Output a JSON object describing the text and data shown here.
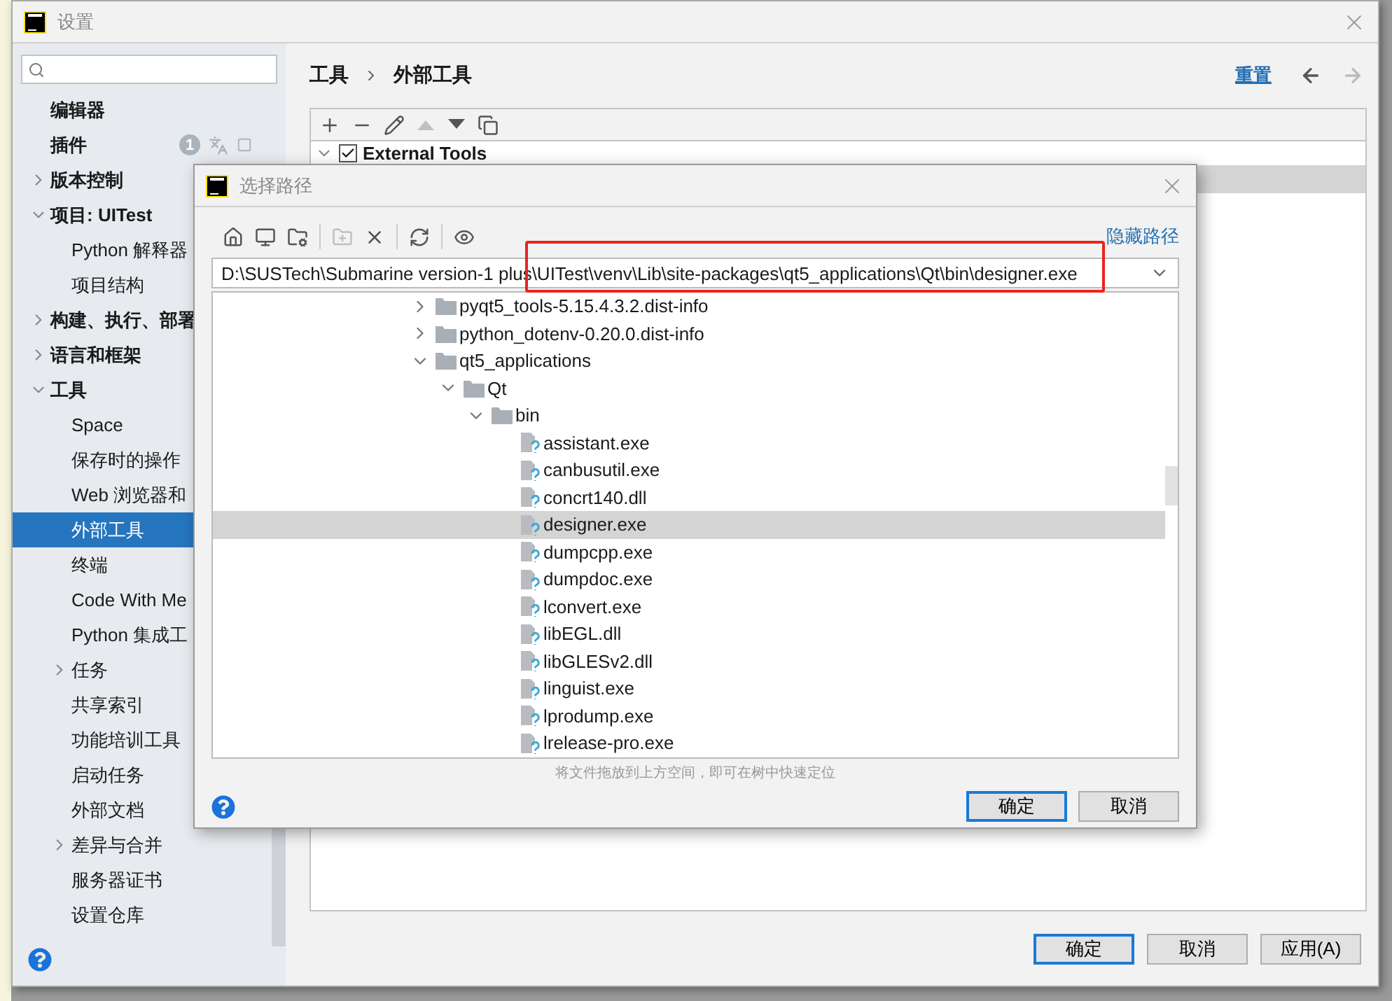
{
  "window": {
    "title": "设置"
  },
  "sidebar": {
    "items": [
      {
        "label": "编辑器",
        "selected": false
      },
      {
        "label": "插件",
        "selected": false,
        "badge": "1"
      },
      {
        "label": "版本控制",
        "selected": false,
        "expanded": false
      },
      {
        "label": "项目: UITest",
        "selected": false,
        "expanded": true,
        "children": [
          {
            "label": "Python 解释器",
            "selected": false
          },
          {
            "label": "项目结构",
            "selected": false
          }
        ]
      },
      {
        "label": "构建、执行、部署",
        "selected": false,
        "expanded": false
      },
      {
        "label": "语言和框架",
        "selected": false,
        "expanded": false
      },
      {
        "label": "工具",
        "selected": false,
        "expanded": true,
        "children": [
          {
            "label": "Space",
            "selected": false
          },
          {
            "label": "保存时的操作",
            "selected": false
          },
          {
            "label": "Web 浏览器和",
            "selected": false
          },
          {
            "label": "外部工具",
            "selected": true
          },
          {
            "label": "终端",
            "selected": false
          },
          {
            "label": "Code With Me",
            "selected": false
          },
          {
            "label": "Python 集成工",
            "selected": false
          },
          {
            "label": "任务",
            "selected": false,
            "expanded": false
          },
          {
            "label": "共享索引",
            "selected": false
          },
          {
            "label": "功能培训工具",
            "selected": false
          },
          {
            "label": "启动任务",
            "selected": false
          },
          {
            "label": "外部文档",
            "selected": false
          },
          {
            "label": "差异与合并",
            "selected": false,
            "expanded": false
          },
          {
            "label": "服务器证书",
            "selected": false
          },
          {
            "label": "设置仓库",
            "selected": false
          }
        ]
      }
    ]
  },
  "breadcrumb": [
    "工具",
    "外部工具"
  ],
  "reset_link": "重置",
  "nav": {
    "back_disabled": false,
    "forward_disabled": true
  },
  "tools_toolbar": [
    {
      "kind": "add",
      "disabled": false
    },
    {
      "kind": "remove",
      "disabled": false
    },
    {
      "kind": "edit",
      "disabled": false
    },
    {
      "kind": "up",
      "disabled": true
    },
    {
      "kind": "down",
      "disabled": false
    },
    {
      "kind": "copy",
      "disabled": false
    }
  ],
  "external_tools": {
    "label": "External Tools",
    "checked": true,
    "expanded": true,
    "children": [
      {
        "selected": true
      }
    ]
  },
  "buttons": [
    {
      "label": "确定",
      "default": true
    },
    {
      "label": "取消",
      "default": false
    },
    {
      "label": "应用(A)",
      "default": false
    }
  ],
  "dialog": {
    "title": "选择路径",
    "toolbar": [
      {
        "kind": "home",
        "disabled": false
      },
      {
        "kind": "desktop",
        "disabled": false
      },
      {
        "kind": "project",
        "disabled": false
      },
      {
        "kind": "sep"
      },
      {
        "kind": "new-folder",
        "disabled": true
      },
      {
        "kind": "delete",
        "disabled": false
      },
      {
        "kind": "sep"
      },
      {
        "kind": "refresh",
        "disabled": false
      },
      {
        "kind": "sep"
      },
      {
        "kind": "hidden",
        "disabled": false
      }
    ],
    "hide_path_link": "隐藏路径",
    "path": "D:\\SUSTech\\Submarine version-1 plus\\UITest\\venv\\Lib\\site-packages\\qt5_applications\\Qt\\bin\\designer.exe",
    "tree": [
      {
        "label": "pyqt5_tools-5.15.4.3.2.dist-info",
        "kind": "folder",
        "expanded": false,
        "selected": false
      },
      {
        "label": "python_dotenv-0.20.0.dist-info",
        "kind": "folder",
        "expanded": false,
        "selected": false
      },
      {
        "label": "qt5_applications",
        "kind": "folder",
        "expanded": true,
        "selected": false,
        "children": [
          {
            "label": "Qt",
            "kind": "folder",
            "expanded": true,
            "selected": false,
            "children": [
              {
                "label": "bin",
                "kind": "folder",
                "expanded": true,
                "selected": false,
                "children": [
                  {
                    "label": "assistant.exe",
                    "kind": "file",
                    "selected": false
                  },
                  {
                    "label": "canbusutil.exe",
                    "kind": "file",
                    "selected": false
                  },
                  {
                    "label": "concrt140.dll",
                    "kind": "file",
                    "selected": false
                  },
                  {
                    "label": "designer.exe",
                    "kind": "file",
                    "selected": true
                  },
                  {
                    "label": "dumpcpp.exe",
                    "kind": "file",
                    "selected": false
                  },
                  {
                    "label": "dumpdoc.exe",
                    "kind": "file",
                    "selected": false
                  },
                  {
                    "label": "lconvert.exe",
                    "kind": "file",
                    "selected": false
                  },
                  {
                    "label": "libEGL.dll",
                    "kind": "file",
                    "selected": false
                  },
                  {
                    "label": "libGLESv2.dll",
                    "kind": "file",
                    "selected": false
                  },
                  {
                    "label": "linguist.exe",
                    "kind": "file",
                    "selected": false
                  },
                  {
                    "label": "lprodump.exe",
                    "kind": "file",
                    "selected": false
                  },
                  {
                    "label": "lrelease-pro.exe",
                    "kind": "file",
                    "selected": false
                  }
                ]
              }
            ]
          }
        ]
      }
    ],
    "hint": "将文件拖放到上方空间，即可在树中快速定位",
    "buttons": [
      {
        "label": "确定",
        "default": true
      },
      {
        "label": "取消",
        "default": false
      }
    ]
  }
}
